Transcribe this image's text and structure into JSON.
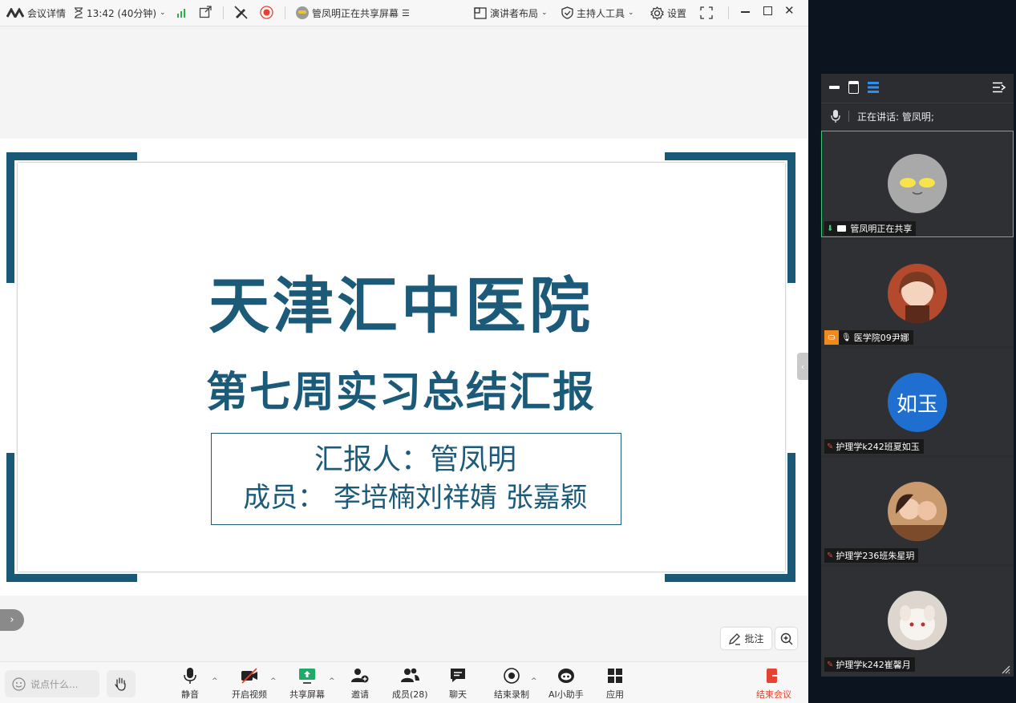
{
  "topbar": {
    "meeting_details": "会议详情",
    "timer": "13:42 (40分钟)",
    "sharing_status": "管凤明正在共享屏幕",
    "presenter_layout": "演讲者布局",
    "host_tools": "主持人工具",
    "settings": "设置"
  },
  "slide": {
    "title": "天津汇中医院",
    "subtitle": "第七周实习总结汇报",
    "reporter": "汇报人：管凤明",
    "members": "成员：  李培楠刘祥婧  张嘉颖"
  },
  "stage_tools": {
    "annotate": "批注"
  },
  "bottom": {
    "chat_placeholder": "说点什么...",
    "mute": "静音",
    "video": "开启视频",
    "share": "共享屏幕",
    "invite": "邀请",
    "members": "成员(28)",
    "chat": "聊天",
    "end_record": "结束录制",
    "ai": "AI小助手",
    "apps": "应用",
    "end_meeting": "结束会议"
  },
  "panel": {
    "speaking": "正在讲话:  管凤明;",
    "participants": [
      {
        "name": "管凤明正在共享"
      },
      {
        "name": "医学院09尹娜"
      },
      {
        "name": "护理学k242班夏如玉",
        "avatar_text": "如玉"
      },
      {
        "name": "护理学236班朱星玥"
      },
      {
        "name": "护理学k242崔馨月"
      }
    ]
  },
  "colors": {
    "slide_accent": "#1b5b79",
    "end_meeting": "#e5432f",
    "active_tile_border": "#3ec97a",
    "avatar_blue": "#1f6fd1"
  }
}
